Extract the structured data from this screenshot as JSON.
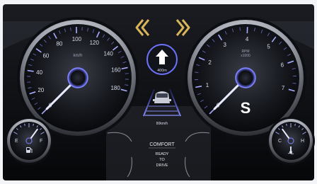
{
  "colors": {
    "accent": "#7f86ff",
    "needle": "#e9ecff",
    "nav_arrow": "#d8b45a",
    "text": "#d9dbe8",
    "panel_bg": "#0b0d12"
  },
  "icons": {
    "left_turn": "double-chevron-left-icon",
    "right_turn": "double-chevron-right-icon",
    "navigation": "up-arrow-icon",
    "car": "car-icon",
    "fuel_pump": "fuel-pump-icon",
    "temperature": "coolant-temperature-icon"
  },
  "navigation": {
    "distance": "400m"
  },
  "adas": {
    "set_speed": "80km/h"
  },
  "status": {
    "mode": "COMFORT",
    "ready_line1": "READY",
    "ready_line2": "TO",
    "ready_line3": "DRIVE"
  },
  "speedometer": {
    "unit": "km/h",
    "ticks": [
      "0",
      "20",
      "40",
      "60",
      "80",
      "100",
      "120",
      "140",
      "160",
      "180"
    ],
    "value": 0
  },
  "tachometer": {
    "unit_line1": "RPM",
    "unit_line2": "x1000",
    "ticks": [
      "0",
      "1",
      "2",
      "3",
      "4",
      "5",
      "6",
      "7"
    ],
    "value": 0,
    "gear": "S"
  },
  "fuel_gauge": {
    "empty_label": "E",
    "full_label": "F",
    "level": 0.8
  },
  "temp_gauge": {
    "cold_label": "C",
    "hot_label": "H",
    "level": 0.2
  }
}
